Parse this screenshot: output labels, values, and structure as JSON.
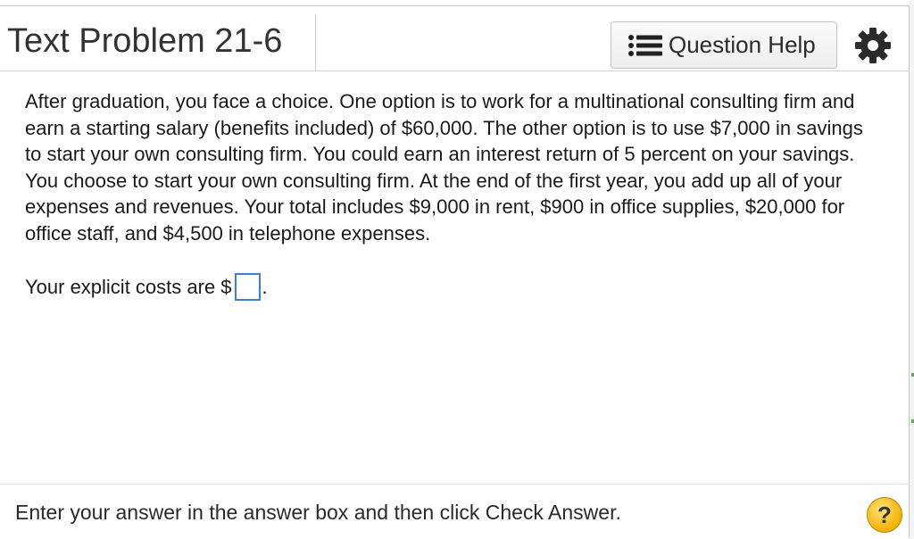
{
  "header": {
    "title": "Text Problem 21-6",
    "help_button_label": "Question Help",
    "list_icon": "list-icon",
    "settings_icon": "gear-icon"
  },
  "problem": {
    "text": "After graduation, you face a choice. One option is to work for a multinational consulting firm and earn a starting salary (benefits included) of $60,000. The other option is to use $7,000 in savings to start your own consulting firm. You could earn an interest return of 5 percent on your savings. You choose to start your own consulting firm. At the end of the first year, you add up all of your expenses and revenues. Your total includes $9,000 in rent, $900 in office supplies, $20,000 for office staff, and $4,500 in telephone expenses.",
    "prompt_prefix": "Your explicit costs are $",
    "prompt_suffix": ".",
    "answer_value": ""
  },
  "footer": {
    "instruction": "Enter your answer in the answer box and then click Check Answer.",
    "help_symbol": "?",
    "help_icon": "question-circle-icon"
  },
  "colors": {
    "answer_box_border": "#3b7fd4",
    "help_circle": "#f2b200"
  }
}
